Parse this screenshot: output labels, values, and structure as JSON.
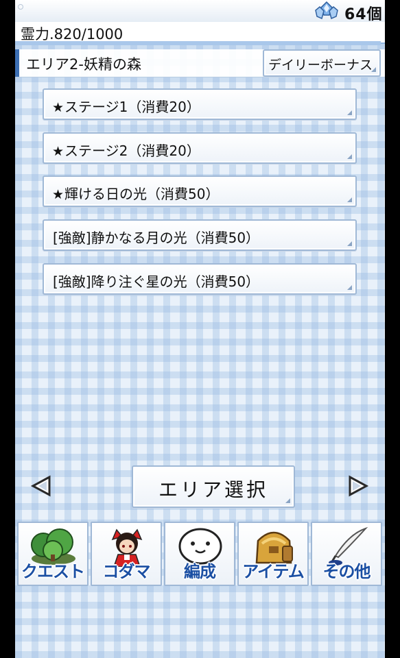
{
  "status": {
    "crystal_icon": "blue-crystal-icon",
    "crystal_count": "64個"
  },
  "power": {
    "label": "霊力.820/1000",
    "current": 820,
    "max": 1000
  },
  "area": {
    "title": "エリア2-妖精の森",
    "daily_bonus": "デイリーボーナス"
  },
  "stages": [
    {
      "star": "★",
      "label": "ステージ1（消費20）"
    },
    {
      "star": "★",
      "label": "ステージ2（消費20）"
    },
    {
      "star": "★",
      "label": "輝ける日の光（消費50）"
    },
    {
      "star": "",
      "label": "[強敵]静かなる月の光（消費50）"
    },
    {
      "star": "",
      "label": "[強敵]降り注ぐ星の光（消費50）"
    }
  ],
  "nav": {
    "area_select": "エリア選択",
    "prev_icon": "left-arrow-icon",
    "next_icon": "right-arrow-icon"
  },
  "menu": [
    {
      "label": "クエスト",
      "icon": "forest-icon"
    },
    {
      "label": "コダマ",
      "icon": "shrine-maiden-icon"
    },
    {
      "label": "編成",
      "icon": "kodama-face-icon"
    },
    {
      "label": "アイテム",
      "icon": "bag-icon"
    },
    {
      "label": "その他",
      "icon": "quill-pen-icon"
    }
  ],
  "colors": {
    "accent": "#3c6fb4",
    "menu_text": "#1b4fa3",
    "background": "#e9f1fa"
  }
}
